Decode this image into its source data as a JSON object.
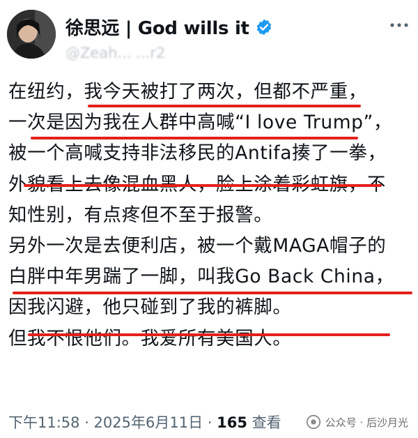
{
  "post": {
    "display_name": "徐思远 | God wills it",
    "handle": "@Zeah...   ...r2",
    "lines": [
      "在纽约，我今天被打了两次，但都不严重，",
      "一次是因为我在人群中高喊“I love Trump”，",
      "被一个高喊支持非法移民的Antifa揍了一拳，",
      "外貌看上去像混血黑人，脸上涂着彩虹旗，不",
      "知性别，有点疼但不至于报警。",
      "另外一次是去便利店，被一个戴MAGA帽子的",
      "白胖中年男踹了一脚，叫我Go Back China，",
      "因我闪避，他只碰到了我的裤脚。",
      "但我不恨他们。我爱所有美国人。"
    ],
    "time": "下午11:58 · 2025年6月11日 · ",
    "views": "165",
    "views_label": " 查看"
  },
  "watermark": {
    "text": "公众号 · 后沙月光"
  },
  "icons": {
    "verified": "verified-badge-icon",
    "more": "more-options-icon",
    "wechat": "wechat-official-account-icon"
  },
  "colors": {
    "verified": "#1d9bf0",
    "underline": "#e3211c",
    "meta": "#536471"
  }
}
